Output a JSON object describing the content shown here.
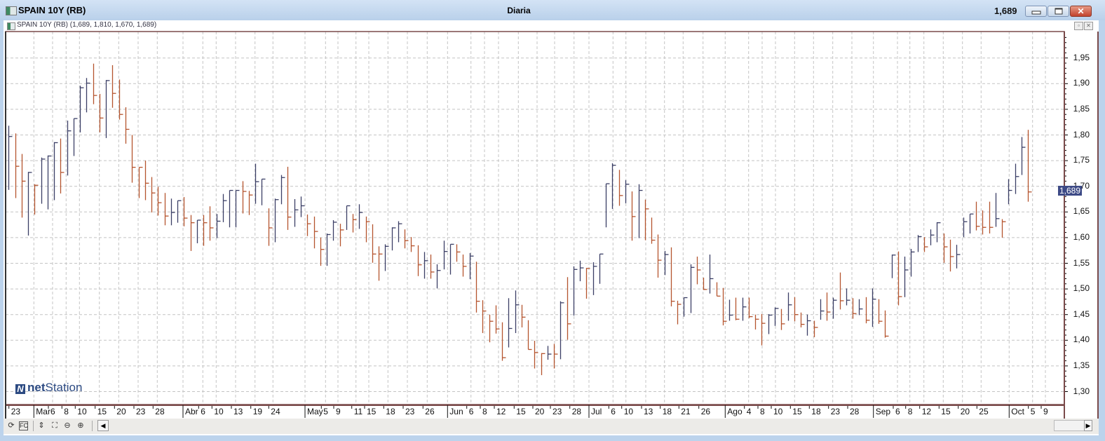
{
  "window": {
    "title": "SPAIN 10Y (RB)",
    "period": "Diaria",
    "last_price": "1,689",
    "buttons": {
      "minimize": "minimize",
      "maximize": "maximize",
      "close": "✕"
    }
  },
  "chart_header": {
    "label": "SPAIN 10Y (RB) (1,689, 1,810, 1,670, 1,689)"
  },
  "logo": {
    "mark": "N",
    "bold": "net",
    "rest": "Station"
  },
  "price_tag": "1,689",
  "toolbar": {
    "icons": [
      "refresh-icon",
      "formula-icon",
      "vertical-scale-icon",
      "zoom-area-icon",
      "zoom-out-icon",
      "zoom-in-icon"
    ],
    "glyphs": [
      "⟳",
      "FC",
      "⇕",
      "⛶",
      "⊖",
      "⊕"
    ],
    "scroll_left": "◀",
    "scroll_right": "▶"
  },
  "colors": {
    "up": "#3b3f66",
    "down": "#b5542e",
    "frame": "#7a4a4a",
    "grid": "#c4c4c4",
    "tag": "#3d4a86"
  },
  "chart_data": {
    "type": "ohlc-bar",
    "title": "SPAIN 10Y (RB)",
    "ylim": [
      1.28,
      1.99
    ],
    "y_ticks": [
      "1,30",
      "1,35",
      "1,40",
      "1,45",
      "1,50",
      "1,55",
      "1,60",
      "1,65",
      "1,70",
      "1,75",
      "1,80",
      "1,85",
      "1,90",
      "1,95"
    ],
    "y_tick_values": [
      1.3,
      1.35,
      1.4,
      1.45,
      1.5,
      1.55,
      1.6,
      1.65,
      1.7,
      1.75,
      1.8,
      1.85,
      1.9,
      1.95
    ],
    "x_tick_labels": [
      "23",
      "Mar",
      "6",
      "8",
      "10",
      "15",
      "20",
      "23",
      "28",
      "Abr",
      "6",
      "10",
      "13",
      "19",
      "24",
      "May",
      "5",
      "9",
      "11",
      "15",
      "18",
      "23",
      "26",
      "Jun",
      "6",
      "8",
      "12",
      "15",
      "20",
      "23",
      "28",
      "Jul",
      "6",
      "10",
      "13",
      "18",
      "21",
      "26",
      "Ago",
      "4",
      "8",
      "10",
      "15",
      "18",
      "23",
      "28",
      "Sep",
      "6",
      "8",
      "12",
      "15",
      "20",
      "25",
      "Oct",
      "5",
      "9"
    ],
    "grid": true,
    "bar_format": "[high, low, close, direction]",
    "bars": [
      [
        1.818,
        1.693,
        1.797,
        "u"
      ],
      [
        1.803,
        1.677,
        1.739,
        "d"
      ],
      [
        1.763,
        1.639,
        1.71,
        "d"
      ],
      [
        1.728,
        1.604,
        1.727,
        "u"
      ],
      [
        1.704,
        1.645,
        1.702,
        "d"
      ],
      [
        1.756,
        1.666,
        1.753,
        "u"
      ],
      [
        1.76,
        1.655,
        1.759,
        "u"
      ],
      [
        1.786,
        1.673,
        1.785,
        "u"
      ],
      [
        1.793,
        1.686,
        1.727,
        "d"
      ],
      [
        1.828,
        1.721,
        1.808,
        "u"
      ],
      [
        1.832,
        1.759,
        1.832,
        "u"
      ],
      [
        1.896,
        1.805,
        1.892,
        "u"
      ],
      [
        1.911,
        1.844,
        1.901,
        "u"
      ],
      [
        1.939,
        1.86,
        1.877,
        "d"
      ],
      [
        1.88,
        1.805,
        1.833,
        "d"
      ],
      [
        1.907,
        1.794,
        1.906,
        "u"
      ],
      [
        1.936,
        1.853,
        1.881,
        "d"
      ],
      [
        1.908,
        1.83,
        1.84,
        "d"
      ],
      [
        1.854,
        1.783,
        1.811,
        "d"
      ],
      [
        1.8,
        1.707,
        1.737,
        "d"
      ],
      [
        1.737,
        1.677,
        1.737,
        "d"
      ],
      [
        1.75,
        1.673,
        1.706,
        "d"
      ],
      [
        1.718,
        1.649,
        1.687,
        "d"
      ],
      [
        1.699,
        1.643,
        1.668,
        "d"
      ],
      [
        1.687,
        1.624,
        1.642,
        "d"
      ],
      [
        1.676,
        1.624,
        1.649,
        "u"
      ],
      [
        1.672,
        1.629,
        1.672,
        "u"
      ],
      [
        1.679,
        1.622,
        1.638,
        "d"
      ],
      [
        1.644,
        1.574,
        1.629,
        "d"
      ],
      [
        1.634,
        1.589,
        1.634,
        "u"
      ],
      [
        1.644,
        1.584,
        1.629,
        "d"
      ],
      [
        1.661,
        1.594,
        1.619,
        "d"
      ],
      [
        1.646,
        1.599,
        1.632,
        "u"
      ],
      [
        1.685,
        1.63,
        1.672,
        "u"
      ],
      [
        1.692,
        1.62,
        1.692,
        "u"
      ],
      [
        1.692,
        1.62,
        1.692,
        "u"
      ],
      [
        1.71,
        1.647,
        1.69,
        "d"
      ],
      [
        1.691,
        1.644,
        1.683,
        "d"
      ],
      [
        1.744,
        1.666,
        1.709,
        "u"
      ],
      [
        1.714,
        1.663,
        1.714,
        "u"
      ],
      [
        1.657,
        1.584,
        1.619,
        "d"
      ],
      [
        1.676,
        1.591,
        1.674,
        "u"
      ],
      [
        1.722,
        1.665,
        1.717,
        "u"
      ],
      [
        1.738,
        1.615,
        1.64,
        "d"
      ],
      [
        1.675,
        1.621,
        1.654,
        "u"
      ],
      [
        1.68,
        1.64,
        1.662,
        "u"
      ],
      [
        1.645,
        1.603,
        1.627,
        "d"
      ],
      [
        1.641,
        1.579,
        1.612,
        "d"
      ],
      [
        1.6,
        1.545,
        1.577,
        "d"
      ],
      [
        1.608,
        1.545,
        1.606,
        "u"
      ],
      [
        1.634,
        1.594,
        1.63,
        "u"
      ],
      [
        1.627,
        1.583,
        1.615,
        "d"
      ],
      [
        1.662,
        1.615,
        1.662,
        "u"
      ],
      [
        1.646,
        1.61,
        1.635,
        "d"
      ],
      [
        1.665,
        1.617,
        1.649,
        "u"
      ],
      [
        1.641,
        1.591,
        1.631,
        "d"
      ],
      [
        1.626,
        1.551,
        1.568,
        "d"
      ],
      [
        1.583,
        1.516,
        1.568,
        "d"
      ],
      [
        1.587,
        1.535,
        1.583,
        "u"
      ],
      [
        1.62,
        1.575,
        1.619,
        "u"
      ],
      [
        1.632,
        1.591,
        1.627,
        "u"
      ],
      [
        1.616,
        1.579,
        1.594,
        "d"
      ],
      [
        1.601,
        1.572,
        1.584,
        "d"
      ],
      [
        1.585,
        1.525,
        1.547,
        "d"
      ],
      [
        1.572,
        1.52,
        1.555,
        "u"
      ],
      [
        1.567,
        1.52,
        1.533,
        "d"
      ],
      [
        1.548,
        1.501,
        1.536,
        "u"
      ],
      [
        1.594,
        1.538,
        1.573,
        "u"
      ],
      [
        1.587,
        1.528,
        1.587,
        "u"
      ],
      [
        1.587,
        1.553,
        1.572,
        "d"
      ],
      [
        1.567,
        1.524,
        1.544,
        "d"
      ],
      [
        1.57,
        1.519,
        1.564,
        "u"
      ],
      [
        1.553,
        1.454,
        1.476,
        "d"
      ],
      [
        1.478,
        1.414,
        1.457,
        "d"
      ],
      [
        1.45,
        1.396,
        1.437,
        "d"
      ],
      [
        1.468,
        1.413,
        1.422,
        "d"
      ],
      [
        1.435,
        1.36,
        1.366,
        "d"
      ],
      [
        1.482,
        1.386,
        1.423,
        "u"
      ],
      [
        1.497,
        1.414,
        1.469,
        "u"
      ],
      [
        1.469,
        1.425,
        1.445,
        "d"
      ],
      [
        1.439,
        1.382,
        1.382,
        "d"
      ],
      [
        1.399,
        1.345,
        1.376,
        "d"
      ],
      [
        1.375,
        1.332,
        1.374,
        "d"
      ],
      [
        1.389,
        1.362,
        1.373,
        "u"
      ],
      [
        1.393,
        1.345,
        1.373,
        "d"
      ],
      [
        1.476,
        1.363,
        1.473,
        "u"
      ],
      [
        1.523,
        1.401,
        1.432,
        "d"
      ],
      [
        1.544,
        1.448,
        1.538,
        "u"
      ],
      [
        1.555,
        1.515,
        1.541,
        "u"
      ],
      [
        1.541,
        1.481,
        1.54,
        "d"
      ],
      [
        1.552,
        1.488,
        1.544,
        "u"
      ],
      [
        1.568,
        1.51,
        1.568,
        "u"
      ],
      [
        1.705,
        1.62,
        1.705,
        "u"
      ],
      [
        1.745,
        1.656,
        1.741,
        "u"
      ],
      [
        1.732,
        1.662,
        1.682,
        "d"
      ],
      [
        1.712,
        1.667,
        1.704,
        "u"
      ],
      [
        1.69,
        1.594,
        1.641,
        "d"
      ],
      [
        1.704,
        1.599,
        1.692,
        "u"
      ],
      [
        1.674,
        1.595,
        1.656,
        "d"
      ],
      [
        1.639,
        1.588,
        1.595,
        "d"
      ],
      [
        1.606,
        1.522,
        1.556,
        "d"
      ],
      [
        1.574,
        1.527,
        1.567,
        "u"
      ],
      [
        1.581,
        1.466,
        1.476,
        "d"
      ],
      [
        1.477,
        1.431,
        1.47,
        "d"
      ],
      [
        1.483,
        1.446,
        1.483,
        "u"
      ],
      [
        1.548,
        1.453,
        1.542,
        "u"
      ],
      [
        1.563,
        1.509,
        1.537,
        "d"
      ],
      [
        1.522,
        1.498,
        1.499,
        "d"
      ],
      [
        1.567,
        1.491,
        1.52,
        "u"
      ],
      [
        1.513,
        1.486,
        1.486,
        "d"
      ],
      [
        1.502,
        1.429,
        1.437,
        "d"
      ],
      [
        1.479,
        1.438,
        1.449,
        "u"
      ],
      [
        1.483,
        1.439,
        1.441,
        "d"
      ],
      [
        1.483,
        1.438,
        1.465,
        "u"
      ],
      [
        1.483,
        1.443,
        1.446,
        "d"
      ],
      [
        1.45,
        1.421,
        1.441,
        "d"
      ],
      [
        1.451,
        1.39,
        1.433,
        "d"
      ],
      [
        1.451,
        1.412,
        1.449,
        "u"
      ],
      [
        1.464,
        1.428,
        1.462,
        "u"
      ],
      [
        1.461,
        1.42,
        1.432,
        "d"
      ],
      [
        1.493,
        1.438,
        1.469,
        "u"
      ],
      [
        1.484,
        1.437,
        1.45,
        "d"
      ],
      [
        1.454,
        1.425,
        1.431,
        "d"
      ],
      [
        1.45,
        1.409,
        1.438,
        "u"
      ],
      [
        1.438,
        1.406,
        1.425,
        "d"
      ],
      [
        1.48,
        1.44,
        1.457,
        "u"
      ],
      [
        1.493,
        1.438,
        1.455,
        "d"
      ],
      [
        1.483,
        1.442,
        1.478,
        "u"
      ],
      [
        1.532,
        1.46,
        1.477,
        "d"
      ],
      [
        1.501,
        1.468,
        1.478,
        "u"
      ],
      [
        1.482,
        1.442,
        1.452,
        "d"
      ],
      [
        1.48,
        1.449,
        1.461,
        "u"
      ],
      [
        1.484,
        1.433,
        1.439,
        "d"
      ],
      [
        1.501,
        1.426,
        1.48,
        "u"
      ],
      [
        1.48,
        1.432,
        1.437,
        "d"
      ],
      [
        1.458,
        1.405,
        1.408,
        "d"
      ],
      [
        1.567,
        1.521,
        1.566,
        "u"
      ],
      [
        1.573,
        1.468,
        1.485,
        "d"
      ],
      [
        1.563,
        1.484,
        1.537,
        "u"
      ],
      [
        1.578,
        1.524,
        1.572,
        "u"
      ],
      [
        1.605,
        1.572,
        1.602,
        "u"
      ],
      [
        1.601,
        1.572,
        1.582,
        "d"
      ],
      [
        1.616,
        1.585,
        1.605,
        "u"
      ],
      [
        1.63,
        1.591,
        1.629,
        "u"
      ],
      [
        1.608,
        1.551,
        1.582,
        "d"
      ],
      [
        1.596,
        1.534,
        1.563,
        "d"
      ],
      [
        1.586,
        1.54,
        1.567,
        "u"
      ],
      [
        1.639,
        1.601,
        1.631,
        "u"
      ],
      [
        1.646,
        1.608,
        1.646,
        "u"
      ],
      [
        1.67,
        1.614,
        1.622,
        "d"
      ],
      [
        1.653,
        1.606,
        1.62,
        "d"
      ],
      [
        1.67,
        1.608,
        1.62,
        "d"
      ],
      [
        1.687,
        1.621,
        1.637,
        "u"
      ],
      [
        1.636,
        1.6,
        1.631,
        "d"
      ],
      [
        1.714,
        1.665,
        1.692,
        "u"
      ],
      [
        1.744,
        1.685,
        1.719,
        "u"
      ],
      [
        1.796,
        1.722,
        1.776,
        "u"
      ],
      [
        1.81,
        1.67,
        1.689,
        "d"
      ]
    ]
  }
}
